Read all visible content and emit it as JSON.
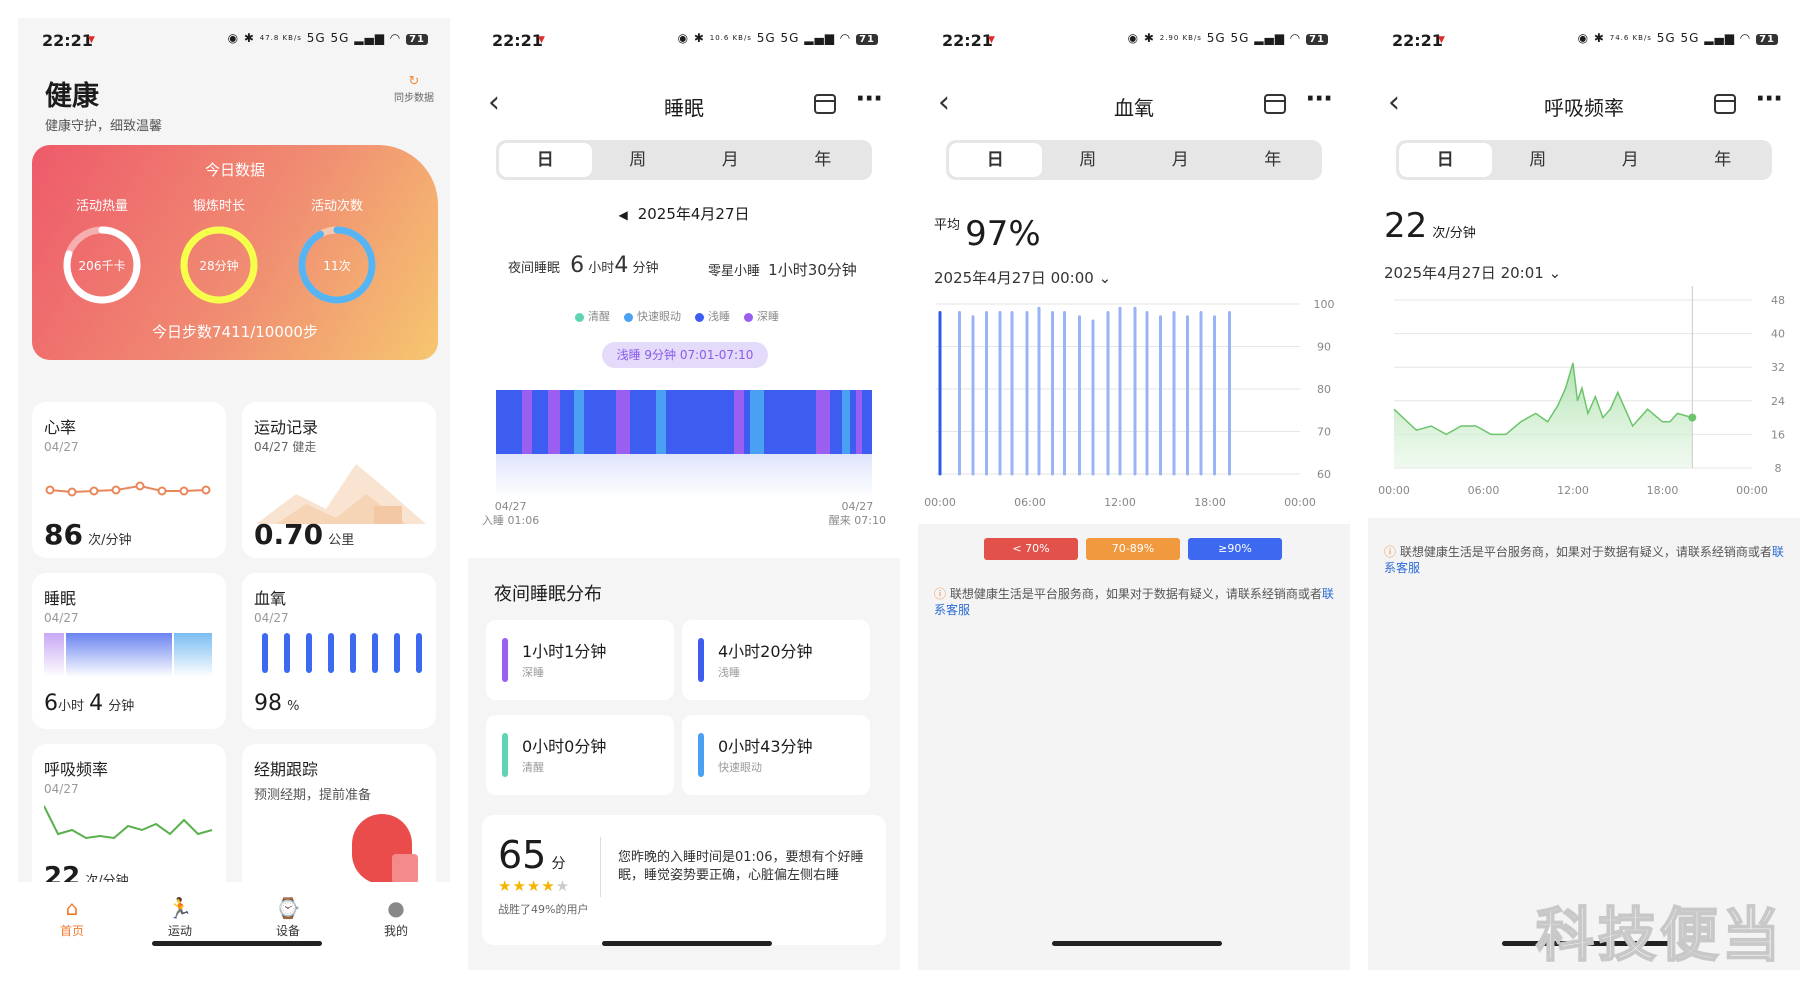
{
  "status_bars": [
    {
      "time": "22:21",
      "speed": "47.8 KB/s",
      "net": "5G 5G",
      "battery": "71"
    },
    {
      "time": "22:21",
      "speed": "10.6 KB/s",
      "net": "5G 5G",
      "battery": "71"
    },
    {
      "time": "22:21",
      "speed": "2.90 KB/s",
      "net": "5G 5G",
      "battery": "71"
    },
    {
      "time": "22:21",
      "speed": "74.6 KB/s",
      "net": "5G 5G",
      "battery": "71"
    }
  ],
  "health": {
    "title": "健康",
    "subtitle": "健康守护，细致温馨",
    "sync_label": "同步数据",
    "today": {
      "heading": "今日数据",
      "rings": [
        {
          "label": "活动热量",
          "value": "206千卡",
          "progress": 0.8,
          "color": "#ffffff"
        },
        {
          "label": "锻炼时长",
          "value": "28分钟",
          "progress": 1.0,
          "color": "#f6ff4a"
        },
        {
          "label": "活动次数",
          "value": "11次",
          "progress": 0.92,
          "color": "#57b4f2"
        }
      ],
      "steps": "今日步数7411/10000步"
    },
    "cards": {
      "heart": {
        "title": "心率",
        "date": "04/27",
        "value": "86",
        "unit": "次/分钟"
      },
      "workout": {
        "title": "运动记录",
        "date": "04/27 健走",
        "value": "0.70",
        "unit": "公里"
      },
      "sleep": {
        "title": "睡眠",
        "date": "04/27",
        "hours": "6",
        "h_unit": "小时",
        "minutes": "4",
        "m_unit": "分钟"
      },
      "spo2": {
        "title": "血氧",
        "date": "04/27",
        "value": "98",
        "unit": "%"
      },
      "breath": {
        "title": "呼吸频率",
        "date": "04/27",
        "value": "22",
        "unit": "次/分钟"
      },
      "period": {
        "title": "经期跟踪",
        "desc": "预测经期，提前准备"
      }
    },
    "nav": [
      {
        "label": "首页",
        "active": true
      },
      {
        "label": "运动",
        "active": false
      },
      {
        "label": "设备",
        "active": false
      },
      {
        "label": "我的",
        "active": false
      }
    ]
  },
  "segments": [
    "日",
    "周",
    "月",
    "年"
  ],
  "sleep": {
    "title": "睡眠",
    "date": "2025年4月27日",
    "night_label": "夜间睡眠",
    "night_h": "6",
    "night_h_unit": "小时",
    "night_m": "4",
    "night_m_unit": "分钟",
    "nap_label": "零星小睡",
    "nap_value": "1小时30分钟",
    "legend": [
      {
        "label": "清醒",
        "color": "#5fd3b2"
      },
      {
        "label": "快速眼动",
        "color": "#4aa0f2"
      },
      {
        "label": "浅睡",
        "color": "#3d5cf0"
      },
      {
        "label": "深睡",
        "color": "#9a5ef0"
      }
    ],
    "tooltip": "浅睡 9分钟 07:01-07:10",
    "start_date": "04/27",
    "start_label": "入睡 01:06",
    "end_date": "04/27",
    "end_label": "醒来 07:10",
    "dist_title": "夜间睡眠分布",
    "dist": [
      {
        "value": "1小时1分钟",
        "label": "深睡",
        "color": "#9a5ef0"
      },
      {
        "value": "4小时20分钟",
        "label": "浅睡",
        "color": "#3d5cf0"
      },
      {
        "value": "0小时0分钟",
        "label": "清醒",
        "color": "#5fd3b2"
      },
      {
        "value": "0小时43分钟",
        "label": "快速眼动",
        "color": "#4aa0f2"
      }
    ],
    "score": "65",
    "score_unit": "分",
    "stars": 3.5,
    "beat": "战胜了49%的用户",
    "advice": "您昨晚的入睡时间是01:06，要想有个好睡眠，睡觉姿势要正确，心脏偏左侧右睡"
  },
  "spo2": {
    "title": "血氧",
    "avg_label": "平均",
    "avg_value": "97%",
    "datetime": "2025年4月27日  00:00",
    "legend": [
      {
        "label": "< 70%",
        "color": "#e2514a"
      },
      {
        "label": "70-89%",
        "color": "#f0993f"
      },
      {
        "label": "≥90%",
        "color": "#3d68f0"
      }
    ],
    "notice": "联想健康生活是平台服务商，如果对于数据有疑义，请联系经销商或者",
    "link": "联系客服"
  },
  "breath": {
    "title": "呼吸频率",
    "value": "22",
    "unit": "次/分钟",
    "datetime": "2025年4月27日  20:01",
    "notice": "联想健康生活是平台服务商，如果对于数据有疑义，请联系经销商或者",
    "link": "联系客服"
  },
  "chart_data": [
    {
      "type": "bar",
      "title": "血氧",
      "x_ticks": [
        "00:00",
        "06:00",
        "12:00",
        "18:00",
        "00:00"
      ],
      "y_ticks": [
        100,
        90,
        80,
        70,
        60
      ],
      "ylim": [
        60,
        100
      ],
      "x_hours": [
        0,
        1.3,
        2.2,
        3.1,
        4,
        4.8,
        5.8,
        6.6,
        7.5,
        8.3,
        9.3,
        10.2,
        11.2,
        12,
        13,
        13.8,
        14.7,
        15.6,
        16.5,
        17.4,
        18.3,
        19.3
      ],
      "values": [
        98,
        98,
        97,
        98,
        98,
        98,
        98,
        99,
        98,
        98,
        97,
        96,
        98,
        99,
        99,
        98,
        97,
        98,
        97,
        98,
        97,
        98
      ]
    },
    {
      "type": "area",
      "title": "呼吸频率",
      "x_ticks": [
        "00:00",
        "06:00",
        "12:00",
        "18:00",
        "00:00"
      ],
      "y_ticks": [
        48,
        40,
        32,
        24,
        16,
        8
      ],
      "ylim": [
        8,
        48
      ],
      "x_hours": [
        0,
        1.5,
        2.5,
        3.5,
        4.5,
        5.5,
        6.5,
        7.5,
        8.5,
        9.5,
        10.3,
        11,
        11.5,
        12,
        12.3,
        12.6,
        13,
        13.5,
        14,
        14.5,
        15,
        16,
        17,
        18,
        18.5,
        19,
        20
      ],
      "values": [
        22,
        17,
        18,
        16,
        18,
        18,
        16,
        16,
        19,
        21,
        19,
        23,
        27,
        33,
        24,
        27,
        21,
        25,
        20,
        22,
        26,
        18,
        22,
        19,
        19,
        21,
        20
      ]
    }
  ],
  "watermark": "科技便当"
}
